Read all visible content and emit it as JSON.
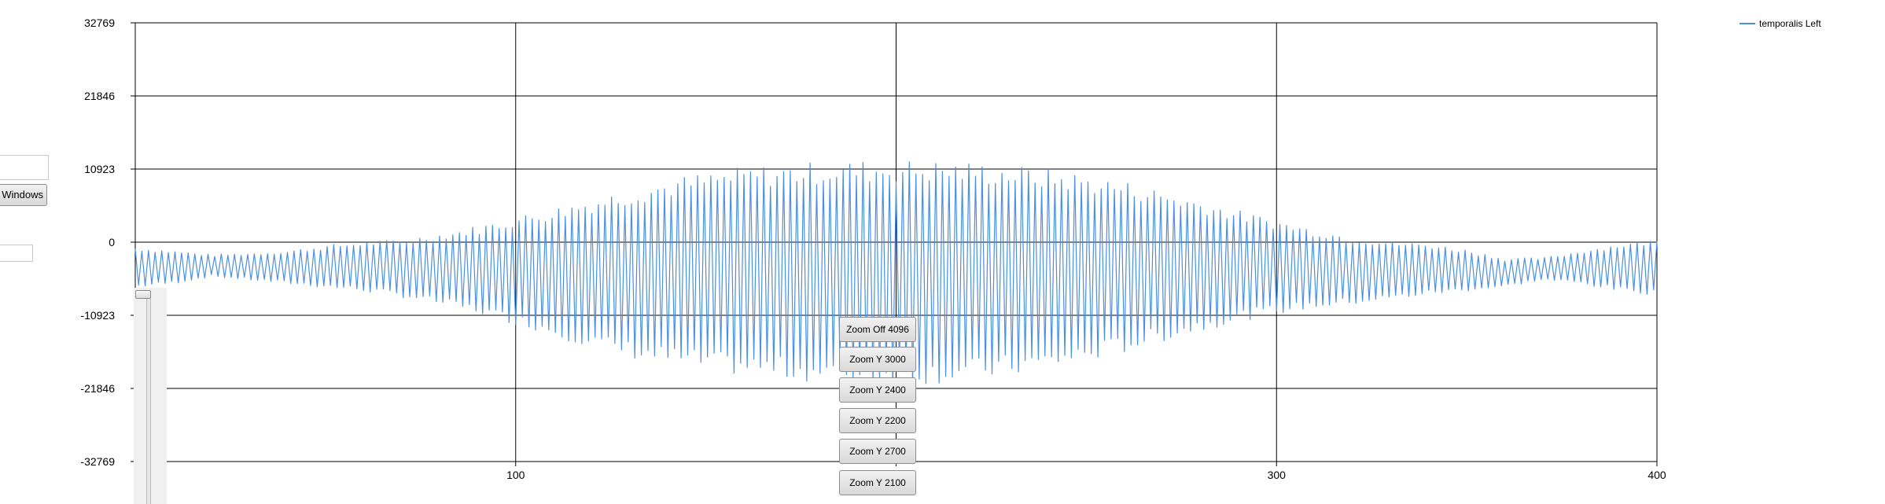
{
  "left_panel": {
    "open_windows_button": "t Windows"
  },
  "zoom_buttons": [
    "Zoom Off 4096",
    "Zoom Y 3000",
    "Zoom Y 2400",
    "Zoom Y 2200",
    "Zoom Y 2700",
    "Zoom Y 2100"
  ],
  "legend": {
    "placement": "top-right",
    "entries": [
      "temporalis Left"
    ]
  },
  "colors": {
    "series": "#4a8fe0",
    "grid": "#000000",
    "button_face": "#e5e5e5"
  },
  "chart_data": {
    "type": "line",
    "title": "",
    "xlabel": "",
    "ylabel": "",
    "xlim": [
      0,
      400
    ],
    "ylim": [
      -32769,
      32769
    ],
    "x_ticks": [
      {
        "value": 100,
        "label": "100"
      },
      {
        "value": 300,
        "label": "300"
      },
      {
        "value": 400,
        "label": "400"
      }
    ],
    "y_ticks": [
      {
        "value": 32769,
        "label": "32769"
      },
      {
        "value": 21846,
        "label": "21846"
      },
      {
        "value": 10923,
        "label": "10923"
      },
      {
        "value": 0,
        "label": "0"
      },
      {
        "value": -10923,
        "label": "-10923"
      },
      {
        "value": -21846,
        "label": "-21846"
      },
      {
        "value": -32769,
        "label": "-32769"
      }
    ],
    "x_gridlines": [
      0,
      100,
      200,
      300,
      400
    ],
    "grid": true,
    "series": [
      {
        "name": "temporalis Left",
        "peak_envelope": {
          "x": [
            0,
            10,
            20,
            30,
            40,
            50,
            60,
            70,
            80,
            90,
            100,
            110,
            120,
            130,
            140,
            150,
            160,
            170,
            180,
            190,
            200,
            210,
            220,
            230,
            240,
            250,
            260,
            270,
            280,
            290,
            300,
            310,
            320,
            330,
            340,
            350,
            360,
            370,
            380,
            390,
            400
          ],
          "max": [
            -1000,
            -1500,
            -2000,
            -1800,
            -1500,
            -800,
            -300,
            0,
            800,
            1800,
            3000,
            4200,
            5500,
            6800,
            8000,
            8900,
            9600,
            10000,
            10300,
            10500,
            10600,
            10500,
            10300,
            9900,
            9400,
            8700,
            7800,
            6600,
            5300,
            3900,
            2600,
            1400,
            400,
            -300,
            -600,
            -1400,
            -2600,
            -2500,
            -1500,
            -600,
            0
          ],
          "min": [
            -6500,
            -6000,
            -5000,
            -5500,
            -6000,
            -6500,
            -7000,
            -7800,
            -8800,
            -10000,
            -11500,
            -13000,
            -14700,
            -16000,
            -17000,
            -17800,
            -18300,
            -18800,
            -19200,
            -19500,
            -19600,
            -19400,
            -19000,
            -18400,
            -17600,
            -16500,
            -15200,
            -13700,
            -12300,
            -11000,
            -10000,
            -9300,
            -8800,
            -8200,
            -7500,
            -7000,
            -6500,
            -5500,
            -6000,
            -7000,
            -7500
          ]
        }
      }
    ]
  }
}
